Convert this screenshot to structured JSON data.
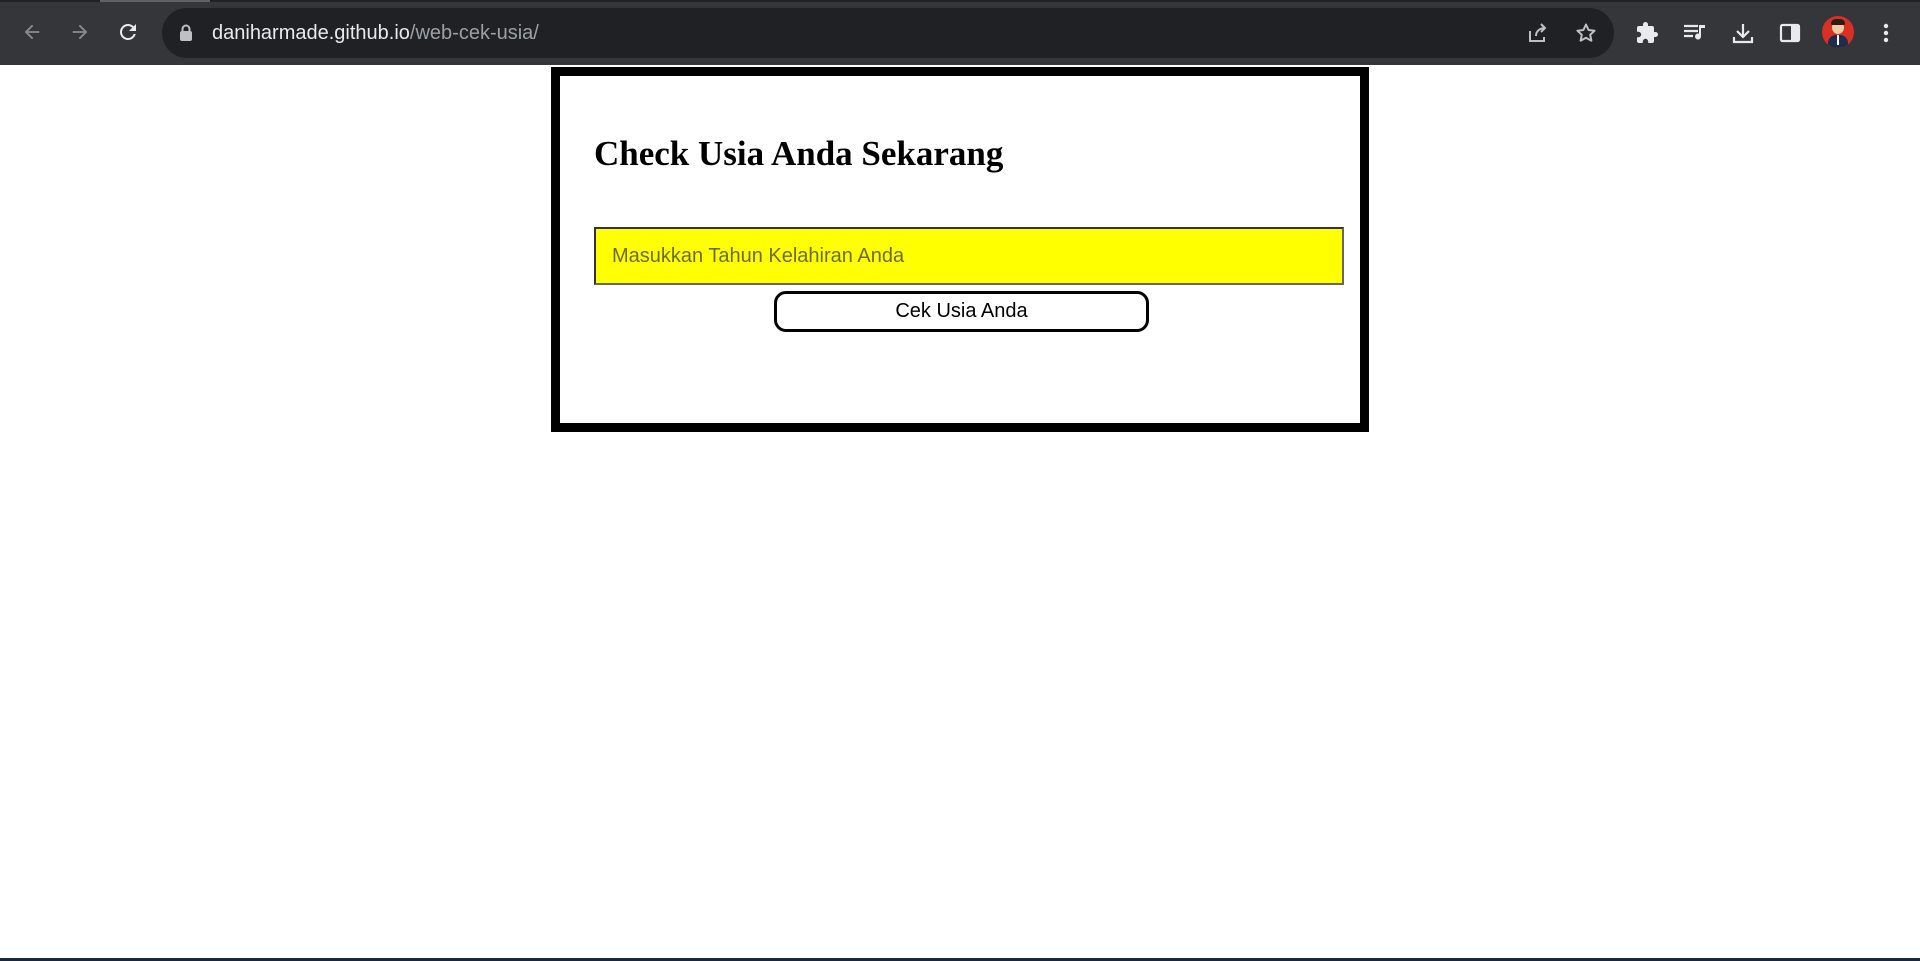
{
  "browser": {
    "url_host": "daniharmade.github.io",
    "url_path": "/web-cek-usia/",
    "icons": {
      "back": "arrow-left-icon",
      "forward": "arrow-right-icon",
      "reload": "reload-icon",
      "lock": "lock-icon",
      "share": "share-icon",
      "bookmark": "star-icon",
      "extensions": "puzzle-icon",
      "media": "media-queue-icon",
      "downloads": "download-icon",
      "side_panel": "side-panel-icon",
      "menu": "kebab-menu-icon"
    }
  },
  "page": {
    "title": "Check Usia Anda Sekarang",
    "input_placeholder": "Masukkan Tahun Kelahiran Anda",
    "input_value": "",
    "button_label": "Cek Usia Anda",
    "colors": {
      "input_background": "#ffff00",
      "card_border": "#000000"
    }
  }
}
